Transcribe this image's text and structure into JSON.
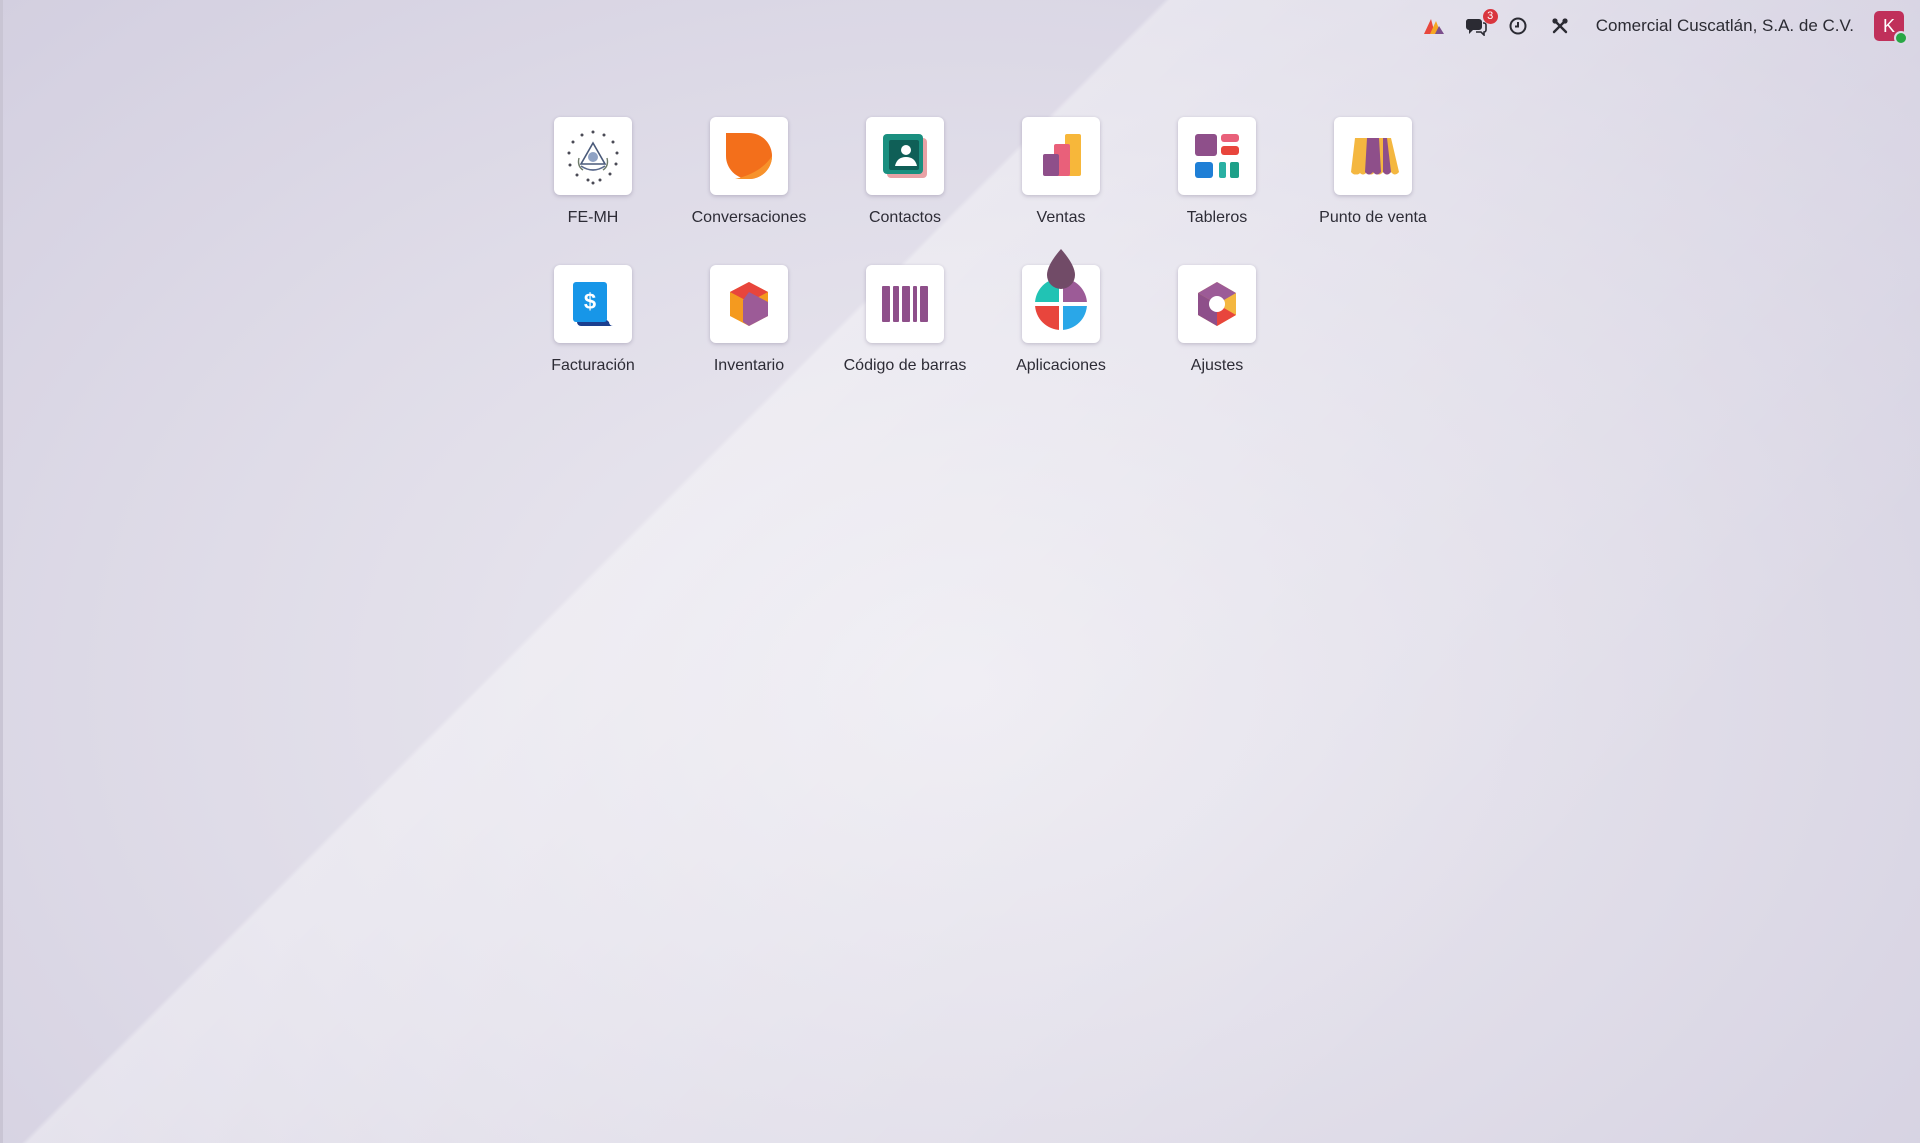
{
  "topbar": {
    "notifications_count": "3",
    "company_name": "Comercial Cuscatlán, S.A. de C.V.",
    "avatar_initial": "K",
    "icons": [
      "brand-logo-icon",
      "chat-icon",
      "clock-icon",
      "tools-icon"
    ]
  },
  "apps": [
    {
      "label": "FE-MH",
      "icon": "seal-icon"
    },
    {
      "label": "Conversaciones",
      "icon": "chat-bubble-icon"
    },
    {
      "label": "Contactos",
      "icon": "contact-card-icon"
    },
    {
      "label": "Ventas",
      "icon": "sales-chart-icon"
    },
    {
      "label": "Tableros",
      "icon": "dashboard-icon"
    },
    {
      "label": "Punto de venta",
      "icon": "storefront-icon"
    },
    {
      "label": "Facturación",
      "icon": "invoice-icon"
    },
    {
      "label": "Inventario",
      "icon": "inventory-cube-icon"
    },
    {
      "label": "Código de barras",
      "icon": "barcode-icon"
    },
    {
      "label": "Aplicaciones",
      "icon": "apps-icon"
    },
    {
      "label": "Ajustes",
      "icon": "settings-icon"
    }
  ],
  "colors": {
    "accent": "#714b67",
    "badge": "#d9363e",
    "avatar": "#c0305a"
  }
}
